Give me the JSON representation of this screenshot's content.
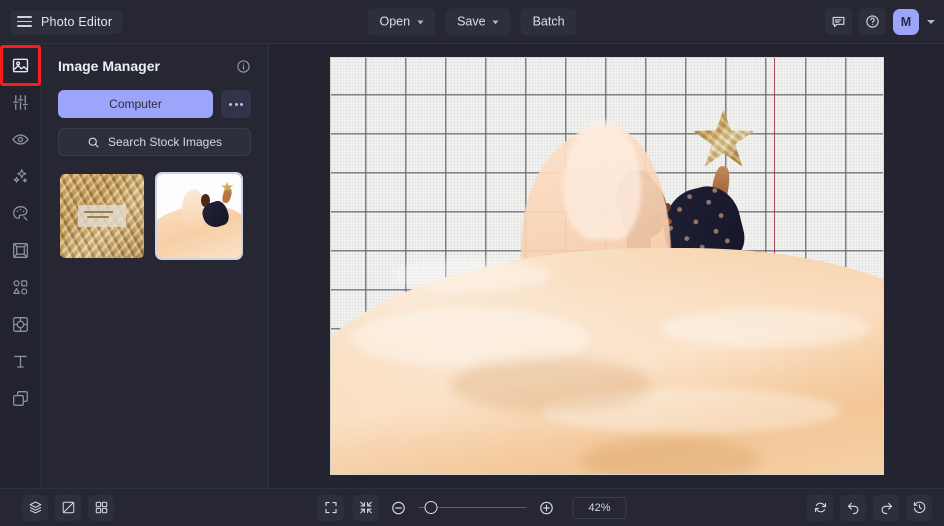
{
  "app": {
    "title": "Photo Editor",
    "accent": "#9da5fb",
    "highlight": "#f91d1d",
    "bg": "#262733"
  },
  "topbar": {
    "menu_icon": "hamburger-icon",
    "open_label": "Open",
    "save_label": "Save",
    "batch_label": "Batch",
    "feedback_icon": "comment-icon",
    "help_icon": "help-circle-icon",
    "avatar_initial": "M",
    "account_chevron": "chevron-down-icon"
  },
  "rail": {
    "items": [
      {
        "name": "image",
        "icon": "image-icon",
        "active": true
      },
      {
        "name": "adjust",
        "icon": "sliders-icon",
        "active": false
      },
      {
        "name": "effects",
        "icon": "eye-icon",
        "active": false
      },
      {
        "name": "enhance",
        "icon": "sparkles-icon",
        "active": false
      },
      {
        "name": "paint",
        "icon": "palette-icon",
        "active": false
      },
      {
        "name": "frames",
        "icon": "frame-icon",
        "active": false
      },
      {
        "name": "shapes",
        "icon": "shapes-icon",
        "active": false
      },
      {
        "name": "overlay",
        "icon": "focus-square-icon",
        "active": false
      },
      {
        "name": "text",
        "icon": "text-icon",
        "active": false
      },
      {
        "name": "layers",
        "icon": "duplicate-layers-icon",
        "active": false
      }
    ]
  },
  "panel": {
    "title": "Image Manager",
    "info_icon": "info-icon",
    "computer_label": "Computer",
    "more_icon": "ellipsis-icon",
    "search_icon": "search-icon",
    "search_label": "Search Stock Images",
    "thumbnails": [
      {
        "name": "gold-foil-thumbnail",
        "selected": false
      },
      {
        "name": "model-photo-thumbnail",
        "selected": true
      }
    ]
  },
  "canvas": {
    "image_alt": "Woman in floral dress holding gold star with flowing peach tulle fabric against grid wall"
  },
  "bottombar": {
    "left_tools": [
      {
        "name": "layers-button",
        "icon": "layers-stack-icon"
      },
      {
        "name": "compare-button",
        "icon": "compare-split-icon"
      },
      {
        "name": "grid-view-button",
        "icon": "grid-four-icon"
      }
    ],
    "center_tools": [
      {
        "name": "fullscreen-button",
        "icon": "expand-corners-icon"
      },
      {
        "name": "fit-screen-button",
        "icon": "collapse-arrows-icon"
      }
    ],
    "zoom_out_icon": "minus-circle-icon",
    "zoom_in_icon": "plus-circle-icon",
    "zoom_level": "42%",
    "slider_percent": 8,
    "right_tools": [
      {
        "name": "reset-button",
        "icon": "refresh-icon"
      },
      {
        "name": "undo-button",
        "icon": "undo-arrow-icon"
      },
      {
        "name": "redo-button",
        "icon": "redo-arrow-icon"
      },
      {
        "name": "history-button",
        "icon": "clock-history-icon"
      }
    ]
  }
}
